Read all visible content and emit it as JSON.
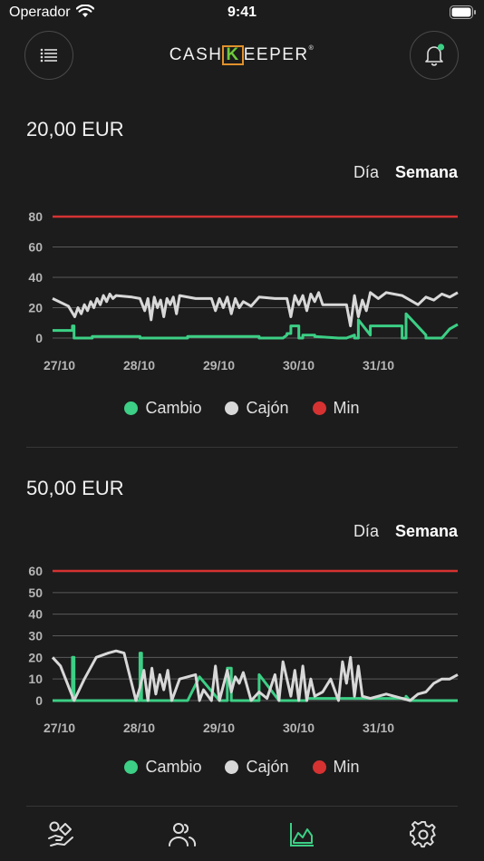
{
  "status_bar": {
    "carrier": "Operador",
    "time": "9:41"
  },
  "header": {
    "logo_prefix": "CASH",
    "logo_k": "K",
    "logo_suffix": "EEPER",
    "logo_mark": "®"
  },
  "colors": {
    "cambio": "#3ccf85",
    "cajon": "#d8d8d8",
    "min": "#d63232",
    "grid": "#5a5a5a",
    "accent_active_tab": "#3ccf85"
  },
  "icons": {
    "menu": "list-icon",
    "bell": "bell-icon",
    "tab_1": "hand-money-icon",
    "tab_2": "users-icon",
    "tab_3": "chart-icon",
    "tab_4": "gear-icon"
  },
  "sections": [
    {
      "title": "20,00 EUR",
      "segment": {
        "day": "Día",
        "week": "Semana",
        "selected": "Semana"
      },
      "legend": {
        "cambio": "Cambio",
        "cajon": "Cajón",
        "min": "Min"
      }
    },
    {
      "title": "50,00 EUR",
      "segment": {
        "day": "Día",
        "week": "Semana",
        "selected": "Semana"
      },
      "legend": {
        "cambio": "Cambio",
        "cajon": "Cajón",
        "min": "Min"
      }
    }
  ],
  "chart_data": [
    {
      "type": "line",
      "x_tick_labels": [
        "27/10",
        "28/10",
        "29/10",
        "30/10",
        "31/10"
      ],
      "x_range": [
        0,
        5.1
      ],
      "y_ticks": [
        0,
        20,
        40,
        60,
        80
      ],
      "ylim": [
        0,
        80
      ],
      "grid": true,
      "legend": "bottom",
      "series": [
        {
          "name": "Min",
          "color": "#d63232",
          "x": [
            0,
            5.1
          ],
          "y": [
            80,
            80
          ]
        },
        {
          "name": "Cajón",
          "color": "#d8d8d8",
          "x": [
            0,
            0.2,
            0.28,
            0.32,
            0.36,
            0.4,
            0.44,
            0.48,
            0.52,
            0.56,
            0.6,
            0.64,
            0.68,
            0.72,
            0.76,
            0.8,
            1.0,
            1.1,
            1.16,
            1.2,
            1.24,
            1.28,
            1.32,
            1.36,
            1.4,
            1.44,
            1.48,
            1.52,
            1.56,
            1.6,
            1.8,
            2.0,
            2.05,
            2.1,
            2.15,
            2.2,
            2.25,
            2.3,
            2.35,
            2.4,
            2.5,
            2.6,
            2.8,
            2.95,
            3.0,
            3.05,
            3.1,
            3.15,
            3.2,
            3.25,
            3.3,
            3.35,
            3.4,
            3.6,
            3.7,
            3.75,
            3.8,
            3.85,
            3.9,
            3.95,
            4.0,
            4.1,
            4.2,
            4.4,
            4.6,
            4.7,
            4.8,
            4.9,
            5.0,
            5.1
          ],
          "y": [
            26,
            21,
            14,
            20,
            16,
            22,
            18,
            24,
            20,
            26,
            22,
            28,
            24,
            29,
            26,
            28,
            27,
            26,
            18,
            26,
            12,
            27,
            20,
            25,
            14,
            26,
            22,
            27,
            16,
            28,
            26,
            26,
            18,
            26,
            20,
            27,
            16,
            26,
            20,
            24,
            21,
            27,
            26,
            26,
            14,
            28,
            22,
            28,
            18,
            29,
            24,
            30,
            22,
            22,
            22,
            8,
            28,
            14,
            25,
            18,
            30,
            26,
            30,
            28,
            22,
            27,
            25,
            29,
            27,
            30
          ]
        },
        {
          "name": "Cambio",
          "color": "#3ccf85",
          "x": [
            0,
            0.25,
            0.25,
            0.27,
            0.27,
            0.5,
            0.5,
            1.1,
            1.1,
            1.7,
            1.7,
            2.6,
            2.6,
            2.9,
            2.95,
            2.95,
            3.0,
            3.0,
            3.1,
            3.1,
            3.15,
            3.15,
            3.3,
            3.3,
            3.6,
            3.7,
            3.8,
            3.8,
            3.85,
            3.85,
            4.0,
            4.0,
            4.4,
            4.4,
            4.45,
            4.45,
            4.7,
            4.7,
            4.9,
            5.0,
            5.1
          ],
          "y": [
            5,
            5,
            8,
            8,
            0,
            0,
            1,
            1,
            0,
            0,
            1,
            1,
            0,
            0,
            2,
            3,
            3,
            8,
            8,
            0,
            0,
            2,
            2,
            1,
            0,
            0,
            2,
            0,
            0,
            12,
            2,
            8,
            8,
            0,
            0,
            16,
            2,
            0,
            0,
            6,
            9
          ]
        }
      ]
    },
    {
      "type": "line",
      "x_tick_labels": [
        "27/10",
        "28/10",
        "29/10",
        "30/10",
        "31/10"
      ],
      "x_range": [
        0,
        5.1
      ],
      "y_ticks": [
        0,
        10,
        20,
        30,
        40,
        50,
        60
      ],
      "ylim": [
        0,
        60
      ],
      "grid": true,
      "legend": "bottom",
      "series": [
        {
          "name": "Min",
          "color": "#d63232",
          "x": [
            0,
            5.1
          ],
          "y": [
            60,
            60
          ]
        },
        {
          "name": "Cajón",
          "color": "#d8d8d8",
          "x": [
            0,
            0.1,
            0.27,
            0.4,
            0.55,
            0.7,
            0.8,
            0.9,
            1.05,
            1.1,
            1.15,
            1.2,
            1.25,
            1.3,
            1.35,
            1.4,
            1.45,
            1.5,
            1.6,
            1.8,
            1.85,
            1.9,
            2.0,
            2.05,
            2.1,
            2.2,
            2.25,
            2.3,
            2.35,
            2.4,
            2.5,
            2.6,
            2.7,
            2.8,
            2.85,
            2.9,
            3.0,
            3.05,
            3.1,
            3.15,
            3.2,
            3.25,
            3.3,
            3.4,
            3.5,
            3.6,
            3.65,
            3.7,
            3.75,
            3.8,
            3.85,
            3.9,
            4.0,
            4.1,
            4.2,
            4.3,
            4.4,
            4.5,
            4.6,
            4.7,
            4.8,
            4.9,
            5.0,
            5.1
          ],
          "y": [
            20,
            16,
            0,
            10,
            20,
            22,
            23,
            22,
            0,
            6,
            14,
            0,
            15,
            3,
            12,
            5,
            14,
            0,
            10,
            12,
            0,
            5,
            0,
            16,
            0,
            14,
            4,
            11,
            8,
            13,
            0,
            4,
            1,
            12,
            0,
            18,
            2,
            14,
            0,
            16,
            0,
            10,
            2,
            4,
            10,
            0,
            18,
            8,
            20,
            2,
            16,
            2,
            1,
            2,
            3,
            2,
            1,
            0,
            3,
            4,
            8,
            10,
            10,
            12
          ]
        },
        {
          "name": "Cambio",
          "color": "#3ccf85",
          "x": [
            0,
            0.25,
            0.25,
            0.27,
            0.27,
            1.1,
            1.1,
            1.12,
            1.12,
            1.7,
            1.85,
            2.1,
            2.2,
            2.2,
            2.25,
            2.25,
            2.6,
            2.6,
            2.85,
            3.2,
            3.2,
            3.5,
            3.8,
            4.45,
            4.45,
            4.5,
            5.1
          ],
          "y": [
            0,
            0,
            20,
            20,
            0,
            0,
            22,
            22,
            0,
            0,
            11,
            0,
            0,
            15,
            15,
            0,
            0,
            12,
            0,
            0,
            1,
            1,
            1,
            1,
            2,
            0,
            0
          ]
        }
      ]
    }
  ]
}
